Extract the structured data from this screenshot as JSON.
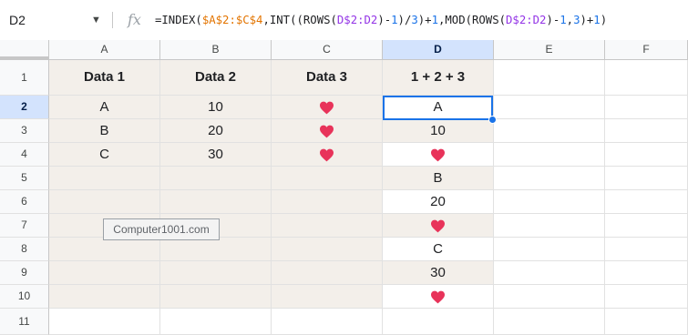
{
  "formula_bar": {
    "cell_ref": "D2",
    "fx_label": "fx",
    "formula_segments": [
      {
        "text": "=INDEX(",
        "color": "default"
      },
      {
        "text": "$A$2:$C$4",
        "color": "orange"
      },
      {
        "text": ",INT((ROWS(",
        "color": "default"
      },
      {
        "text": "D$2:D2",
        "color": "purple"
      },
      {
        "text": ")-",
        "color": "default"
      },
      {
        "text": "1",
        "color": "blue"
      },
      {
        "text": ")/",
        "color": "default"
      },
      {
        "text": "3",
        "color": "blue"
      },
      {
        "text": ")+",
        "color": "default"
      },
      {
        "text": "1",
        "color": "blue"
      },
      {
        "text": ",MOD(ROWS(",
        "color": "default"
      },
      {
        "text": "D$2:D2",
        "color": "purple"
      },
      {
        "text": ")-",
        "color": "default"
      },
      {
        "text": "1",
        "color": "blue"
      },
      {
        "text": ",",
        "color": "default"
      },
      {
        "text": "3",
        "color": "blue"
      },
      {
        "text": ")+",
        "color": "default"
      },
      {
        "text": "1",
        "color": "blue"
      },
      {
        "text": ")",
        "color": "default"
      }
    ]
  },
  "columns": [
    "A",
    "B",
    "C",
    "D",
    "E",
    "F"
  ],
  "selected_column": "D",
  "rows": [
    "1",
    "2",
    "3",
    "4",
    "5",
    "6",
    "7",
    "8",
    "9",
    "10",
    "11"
  ],
  "selected_row": "2",
  "headers": {
    "a": "Data 1",
    "b": "Data 2",
    "c": "Data 3",
    "d": "1 + 2 + 3"
  },
  "source_rows": [
    {
      "a": "A",
      "b": "10",
      "c": "heart"
    },
    {
      "a": "B",
      "b": "20",
      "c": "heart"
    },
    {
      "a": "C",
      "b": "30",
      "c": "heart"
    }
  ],
  "result_column": [
    "A",
    "10",
    "heart",
    "B",
    "20",
    "heart",
    "C",
    "30",
    "heart"
  ],
  "watermark": "Computer1001.com",
  "colors": {
    "band": "#f3efea",
    "selection": "#1a73e8",
    "selected_header": "#d3e3fd",
    "heart": "#e8335a"
  }
}
